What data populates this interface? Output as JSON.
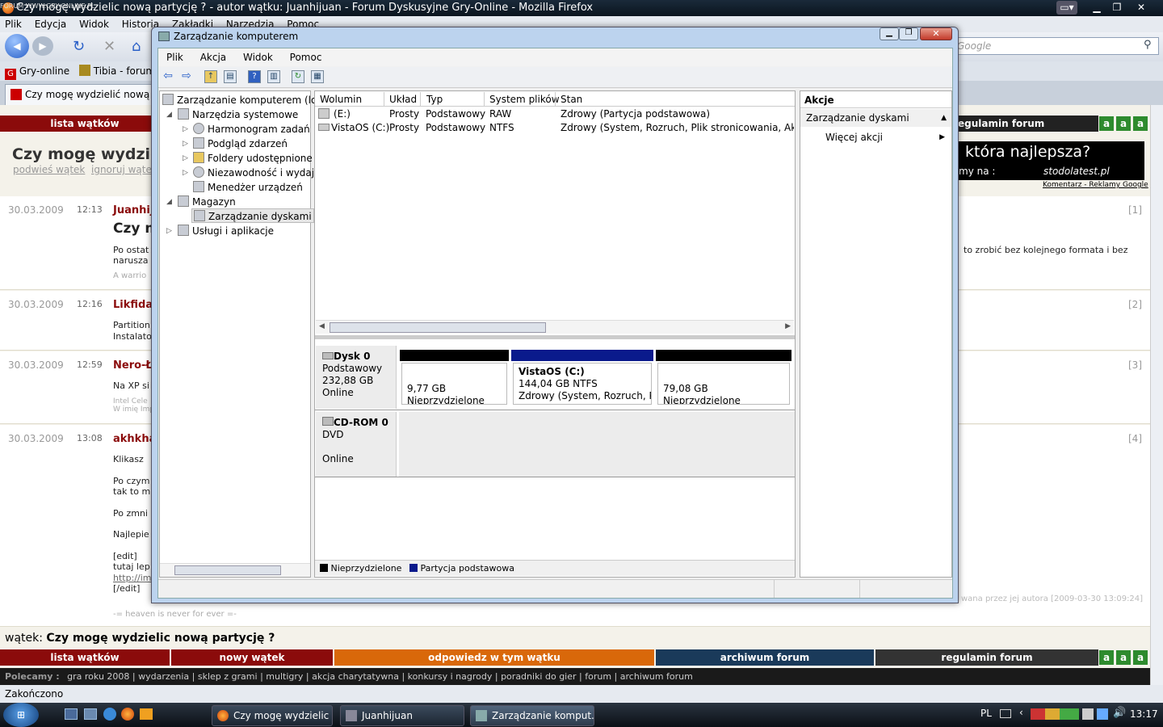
{
  "firefox": {
    "watermark": "FORUM WWW.GRY-ONLINE.PL",
    "title": "Czy mogę wydzielic nową partycję ? - autor wątku: Juanhijuan - Forum Dyskusyjne Gry-Online - Mozilla Firefox",
    "menu": [
      "Plik",
      "Edycja",
      "Widok",
      "Historia",
      "Zakładki",
      "Narzędzia",
      "Pomoc"
    ],
    "search_placeholder": "Google",
    "bookmarks": [
      "Gry-online",
      "Tibia - forum"
    ],
    "tab": "Czy mogę wydzielić nową pa"
  },
  "forum": {
    "lista": "lista wątków",
    "regulamin_top": "egulamin forum",
    "title": "Czy mogę wydzieli",
    "podbij": "podwieś wątek",
    "ignoruj": "ignoruj wątek",
    "ad1": "która najlepsza?",
    "ad2": "my na :",
    "ad3": "stodolatest.pl",
    "ad_link": "Komentarz - Reklamy Google",
    "posts": [
      {
        "date": "30.03.2009",
        "time": "12:13",
        "author": "Juanhij",
        "num": "[1]",
        "heading": "Czy m",
        "l1": "Po ostat",
        "l2": "narusza",
        "l3": "A warrio",
        "right": "to zrobić bez kolejnego formata i bez"
      },
      {
        "date": "30.03.2009",
        "time": "12:16",
        "author": "Likfida",
        "num": "[2]",
        "l1": "Partition",
        "l2": "Instalato"
      },
      {
        "date": "30.03.2009",
        "time": "12:59",
        "author": "Nero-Ł",
        "num": "[3]",
        "l1": "Na XP si",
        "l2": "Intel Cele",
        "l3": "W imię Imp"
      },
      {
        "date": "30.03.2009",
        "time": "13:08",
        "author": "akhkha",
        "num": "[4]",
        "l1": "Klikasz ",
        "l2": "Po czym",
        "l3": "tak to m",
        "l4": "Po zmni",
        "l5": "Najlepie",
        "l6": "[edit]",
        "l7": "tutaj lep",
        "l8": "http://img",
        "l9": "[/edit]",
        "edited": "wana przez jej autora [2009-03-30 13:09:24]",
        "sig": "-= heaven is never for ever =-"
      }
    ],
    "watek_label": "wątek:",
    "watek_title": "Czy mogę wydzielic nową partycję ?",
    "bottom_nav": [
      "lista wątków",
      "nowy wątek",
      "odpowiedz w tym wątku",
      "archiwum forum",
      "regulamin forum"
    ],
    "polecamy_label": "Polecamy :",
    "polecamy": [
      "gra roku 2008",
      "wydarzenia",
      "sklep z grami",
      "multigry",
      "akcja charytatywna",
      "konkursy i nagrody",
      "poradniki do gier",
      "forum",
      "archiwum forum"
    ],
    "a": "a",
    "status": "Zakończono"
  },
  "mmc": {
    "title": "Zarządzanie komputerem",
    "menu": [
      "Plik",
      "Akcja",
      "Widok",
      "Pomoc"
    ],
    "tree": {
      "root": "Zarządzanie komputerem (loka",
      "sys": "Narzędzia systemowe",
      "harm": "Harmonogram zadań",
      "podg": "Podgląd zdarzeń",
      "fold": "Foldery udostępnione",
      "niez": "Niezawodność i wydajn",
      "men": "Menedżer urządzeń",
      "mag": "Magazyn",
      "disk": "Zarządzanie dyskami",
      "usl": "Usługi i aplikacje"
    },
    "columns": [
      "Wolumin",
      "Układ",
      "Typ",
      "System plików",
      "Stan"
    ],
    "volumes": [
      {
        "vol": "(E:)",
        "layout": "Prosty",
        "type": "Podstawowy",
        "fs": "RAW",
        "status": "Zdrowy (Partycja podstawowa)"
      },
      {
        "vol": "VistaOS (C:)",
        "layout": "Prosty",
        "type": "Podstawowy",
        "fs": "NTFS",
        "status": "Zdrowy (System, Rozruch, Plik stronicowania, Aktywna,"
      }
    ],
    "disk0": {
      "name": "Dysk 0",
      "type": "Podstawowy",
      "size": "232,88 GB",
      "state": "Online",
      "p1_size": "9,77 GB",
      "p1_label": "Nieprzydzielone",
      "p2_name": "VistaOS  (C:)",
      "p2_size": "144,04 GB NTFS",
      "p2_status": "Zdrowy (System, Rozruch, Plik",
      "p3_size": "79,08 GB",
      "p3_label": "Nieprzydzielone"
    },
    "cdrom": {
      "name": "CD-ROM 0",
      "type": "DVD",
      "state": "Online"
    },
    "legend": [
      "Nieprzydzielone",
      "Partycja podstawowa"
    ],
    "actions": {
      "header": "Akcje",
      "section": "Zarządzanie dyskami",
      "more": "Więcej akcji"
    },
    "colors": {
      "unallocated": "#000000",
      "primary": "#0a1a8c"
    }
  },
  "taskbar": {
    "items": [
      "Czy mogę wydzielic ...",
      "Juanhijuan",
      "Zarządzanie komput..."
    ],
    "lang": "PL",
    "time": "13:17"
  }
}
